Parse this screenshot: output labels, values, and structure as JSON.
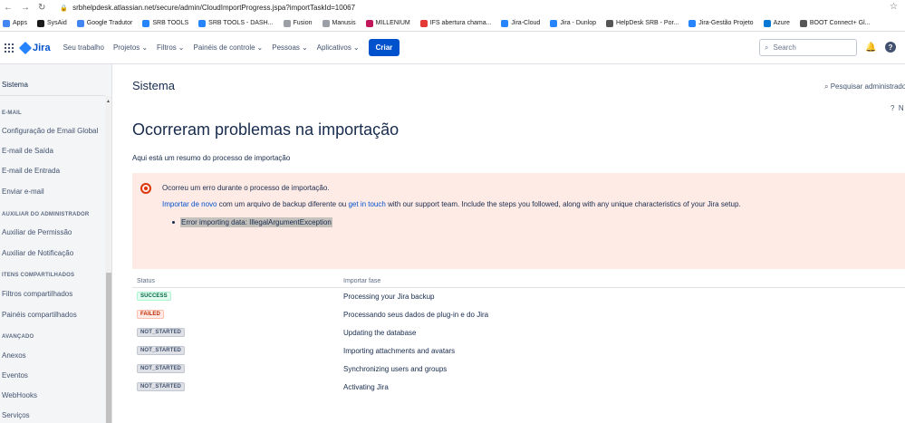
{
  "browser": {
    "url": "srbhelpdesk.atlassian.net/secure/admin/CloudImportProgress.jspa?importTaskId=10067",
    "bookmarks": [
      {
        "label": "Apps",
        "color": "#4285f4"
      },
      {
        "label": "SysAid",
        "color": "#1a1a1a"
      },
      {
        "label": "Google Tradutor",
        "color": "#4285f4"
      },
      {
        "label": "SRB TOOLS",
        "color": "#2684ff"
      },
      {
        "label": "SRB TOOLS - DASH...",
        "color": "#2684ff"
      },
      {
        "label": "Fusion",
        "color": "#9aa0a6"
      },
      {
        "label": "Manusis",
        "color": "#9aa0a6"
      },
      {
        "label": "MILLENIUM",
        "color": "#c2185b"
      },
      {
        "label": "IFS abertura chama...",
        "color": "#e53935"
      },
      {
        "label": "Jira-Cloud",
        "color": "#2684ff"
      },
      {
        "label": "Jira - Dunlop",
        "color": "#2684ff"
      },
      {
        "label": "HelpDesk SRB - Por...",
        "color": "#555"
      },
      {
        "label": "Jira-Gestão Projeto",
        "color": "#2684ff"
      },
      {
        "label": "Azure",
        "color": "#0078d4"
      },
      {
        "label": "BOOT Connect+ Gl...",
        "color": "#555"
      }
    ]
  },
  "header": {
    "logo": "Jira",
    "nav": [
      "Seu trabalho",
      "Projetos",
      "Filtros",
      "Painéis de controle",
      "Pessoas",
      "Aplicativos"
    ],
    "create_label": "Criar",
    "search_placeholder": "Search"
  },
  "sidebar": {
    "title": "Sistema",
    "sections": [
      {
        "heading": "E-MAIL",
        "items": [
          "Configuração de Email Global",
          "E-mail de Saída",
          "E-mail de Entrada",
          "Enviar e-mail"
        ]
      },
      {
        "heading": "AUXILIAR DO ADMINISTRADOR",
        "items": [
          "Auxiliar de Permissão",
          "Auxiliar de Notificação"
        ]
      },
      {
        "heading": "ITENS COMPARTILHADOS",
        "items": [
          "Filtros compartilhados",
          "Painéis compartilhados"
        ]
      },
      {
        "heading": "AVANÇADO",
        "items": [
          "Anexos",
          "Eventos",
          "WebHooks",
          "Serviços"
        ]
      }
    ]
  },
  "main": {
    "section_title": "Sistema",
    "admin_search": "Pesquisar administrado",
    "help_mini": "N",
    "heading": "Ocorreram problemas na importação",
    "summary": "Aqui está um resumo do processo de importação",
    "error": {
      "title": "Ocorreu um erro durante o processo de importação.",
      "link1": "Importar de novo",
      "text1": " com um arquivo de backup diferente ou ",
      "link2": "get in touch",
      "text2": " with our support team. Include the steps you followed, along with any unique characteristics of your Jira setup.",
      "detail": "Error importing data: IllegalArgumentException"
    },
    "table": {
      "col_status": "Status",
      "col_phase": "Importar fase",
      "rows": [
        {
          "status": "SUCCESS",
          "phase": "Processing your Jira backup"
        },
        {
          "status": "FAILED",
          "phase": "Processando seus dados de plug-in e do Jira"
        },
        {
          "status": "NOT_STARTED",
          "phase": "Updating the database"
        },
        {
          "status": "NOT_STARTED",
          "phase": "Importing attachments and avatars"
        },
        {
          "status": "NOT_STARTED",
          "phase": "Synchronizing users and groups"
        },
        {
          "status": "NOT_STARTED",
          "phase": "Activating Jira"
        }
      ]
    }
  }
}
